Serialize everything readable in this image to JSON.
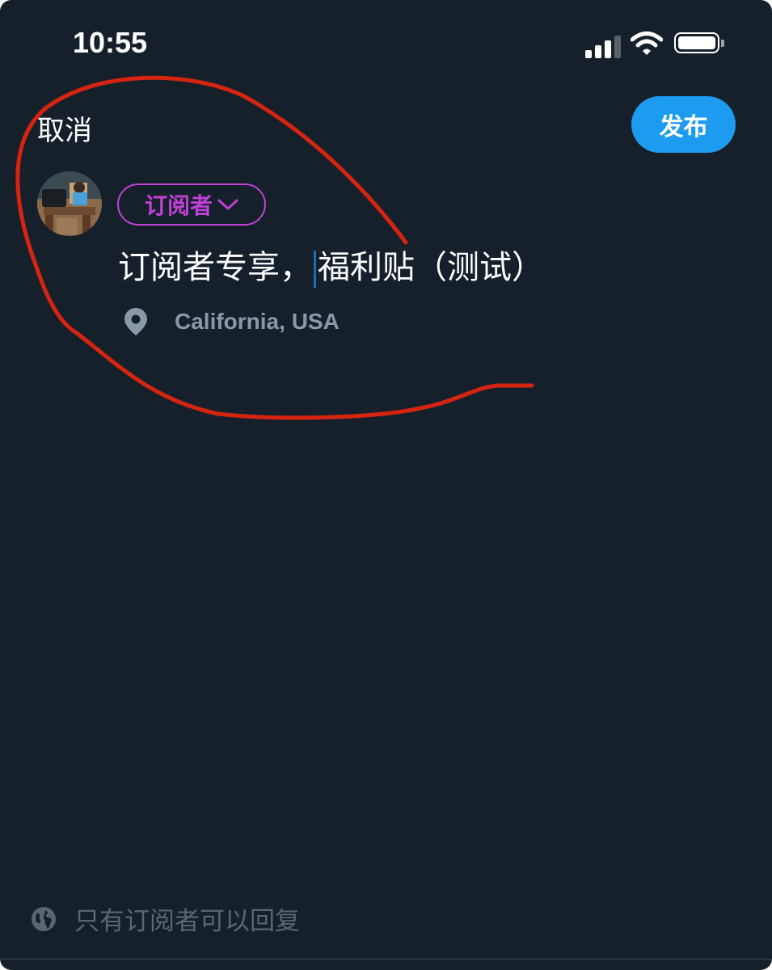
{
  "status_bar": {
    "time": "10:55"
  },
  "header": {
    "cancel_label": "取消",
    "publish_label": "发布"
  },
  "composer": {
    "audience_label": "订阅者",
    "text_before_cursor": "订阅者专享，",
    "text_after_cursor": "福利贴（测试）",
    "location": "California, USA"
  },
  "footer": {
    "reply_setting": "只有订阅者可以回复"
  },
  "icons": {
    "audience_chevron": "chevron-down-icon",
    "location": "map-pin-icon",
    "reply_setting": "globe-icon"
  },
  "colors": {
    "background": "#16202b",
    "accent": "#1d9bf0",
    "audience": "#c140d6",
    "muted_text": "#8b98a5",
    "annotation_stroke": "#d62410"
  }
}
